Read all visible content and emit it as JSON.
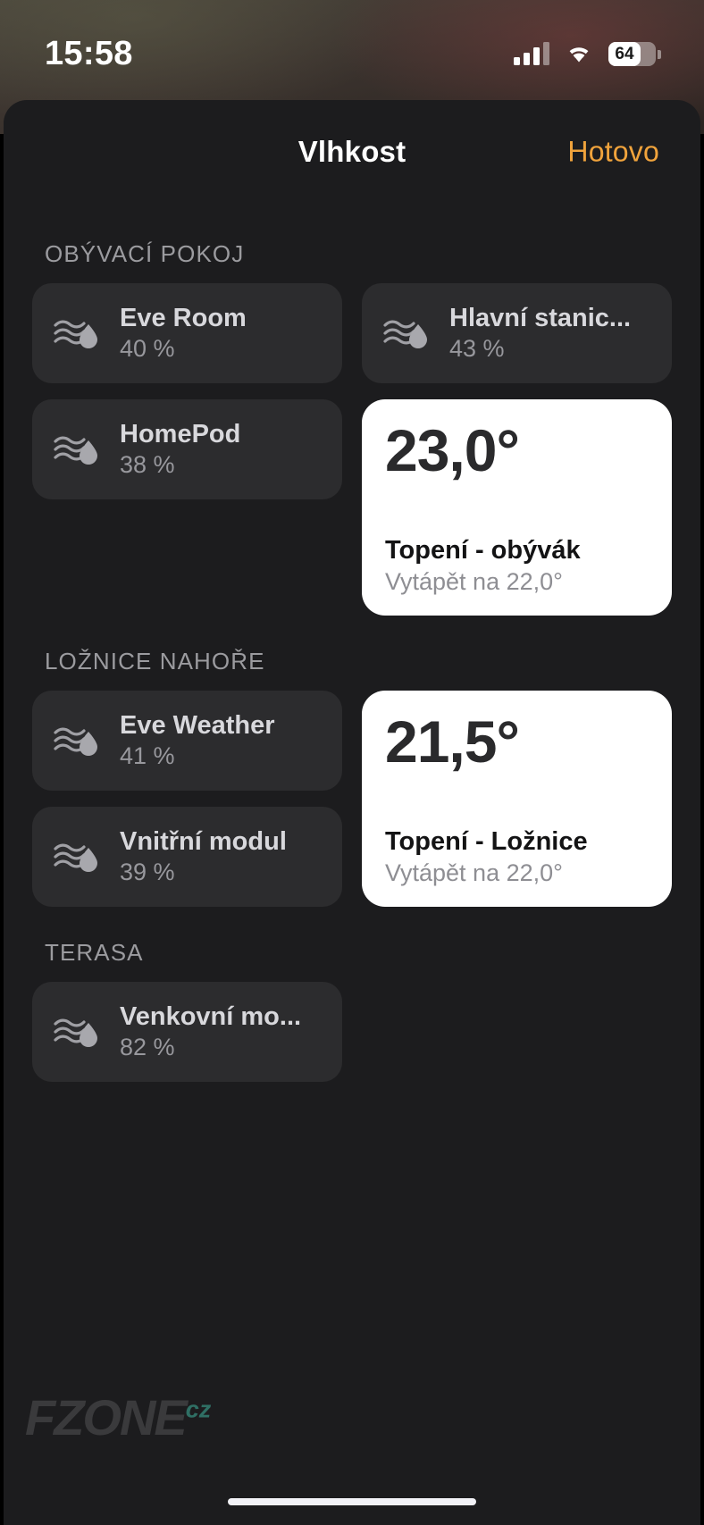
{
  "status_bar": {
    "time": "15:58",
    "battery_percent": "64",
    "icons": {
      "cellular": "cellular-signal-icon",
      "wifi": "wifi-icon",
      "battery": "battery-icon"
    }
  },
  "nav": {
    "title": "Vlhkost",
    "done_label": "Hotovo"
  },
  "colors": {
    "accent": "#f0a33c",
    "sheet_bg": "#1c1c1e",
    "tile_bg": "#2c2c2e",
    "card_bg": "#ffffff",
    "section_title": "#9b9b9f",
    "tile_name": "#d8d8dc",
    "tile_value": "#98989d"
  },
  "sections": [
    {
      "title": "OBÝVACÍ POKOJ",
      "left_tiles": [
        {
          "icon": "humidity-icon",
          "name": "Eve Room",
          "value": "40 %"
        },
        {
          "icon": "humidity-icon",
          "name": "HomePod",
          "value": "38 %"
        }
      ],
      "right_tiles": [
        {
          "icon": "humidity-icon",
          "name": "Hlavní stanic...",
          "value": "43 %"
        }
      ],
      "thermostat": {
        "temperature": "23,0°",
        "name": "Topení - obývák",
        "subtitle": "Vytápět na 22,0°"
      }
    },
    {
      "title": "LOŽNICE NAHOŘE",
      "left_tiles": [
        {
          "icon": "humidity-icon",
          "name": "Eve Weather",
          "value": "41 %"
        },
        {
          "icon": "humidity-icon",
          "name": "Vnitřní modul",
          "value": "39 %"
        }
      ],
      "right_tiles": [],
      "thermostat": {
        "temperature": "21,5°",
        "name": "Topení - Ložnice",
        "subtitle": "Vytápět na 22,0°"
      }
    },
    {
      "title": "TERASA",
      "left_tiles": [
        {
          "icon": "humidity-icon",
          "name": "Venkovní mo...",
          "value": "82 %"
        }
      ],
      "right_tiles": [],
      "thermostat": null
    }
  ],
  "watermark": {
    "text": "FZONE",
    "suffix": "cz"
  }
}
